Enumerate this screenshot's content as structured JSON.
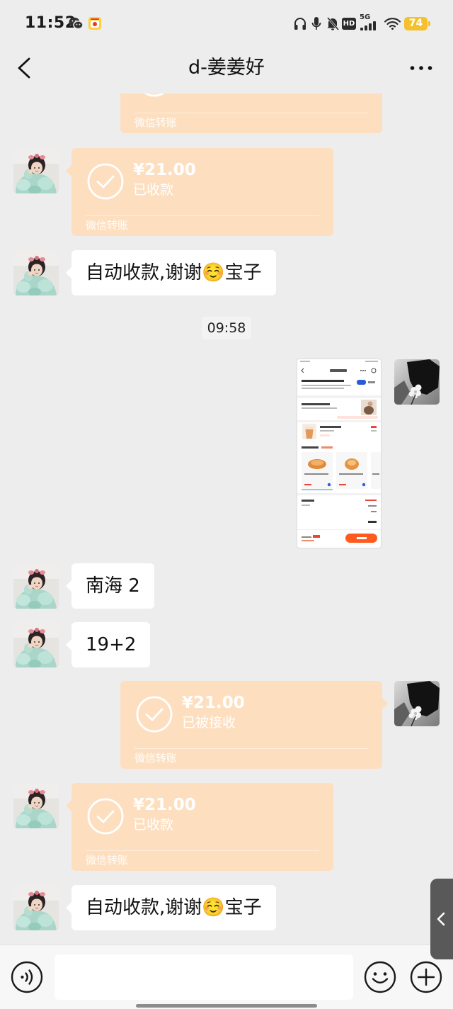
{
  "status_bar": {
    "time": "11:52",
    "hd": "HD",
    "network": "5G",
    "battery": "74",
    "icons": [
      "wechat-icon",
      "app-notification-icon",
      "headphones-icon",
      "mic-icon",
      "bell-muted-icon",
      "signal-icon",
      "wifi-icon",
      "battery-icon"
    ]
  },
  "header": {
    "title": "d-姜姜好",
    "back_icon": "chevron-left-icon",
    "more_icon": "more-dots-icon"
  },
  "messages": [
    {
      "footer": "微信转账"
    },
    {
      "amount": "¥21.00",
      "status": "已收款",
      "footer": "微信转账"
    },
    {
      "text": "自动收款,谢谢☺️宝子"
    },
    {
      "time": "09:58"
    },
    {
      "accent": "#ff5b1e"
    },
    {
      "text": "南海 2"
    },
    {
      "text": "19+2"
    },
    {
      "amount": "¥21.00",
      "status": "已被接收",
      "footer": "微信转账"
    },
    {
      "amount": "¥21.00",
      "status": "已收款",
      "footer": "微信转账"
    },
    {
      "text": "自动收款,谢谢☺️宝子"
    }
  ],
  "composer": {
    "voice_icon": "voice-icon",
    "emoji_icon": "emoji-icon",
    "plus_icon": "plus-icon"
  },
  "side_tab": {
    "icon": "chevron-left-icon"
  },
  "colors": {
    "chat_background": "#ededed",
    "text_bubble": "#ffffff",
    "transfer_done": "#fddfc0",
    "composer_background": "#f7f7f7",
    "battery_fill": "#f4c12d",
    "side_tab": "#595959"
  }
}
